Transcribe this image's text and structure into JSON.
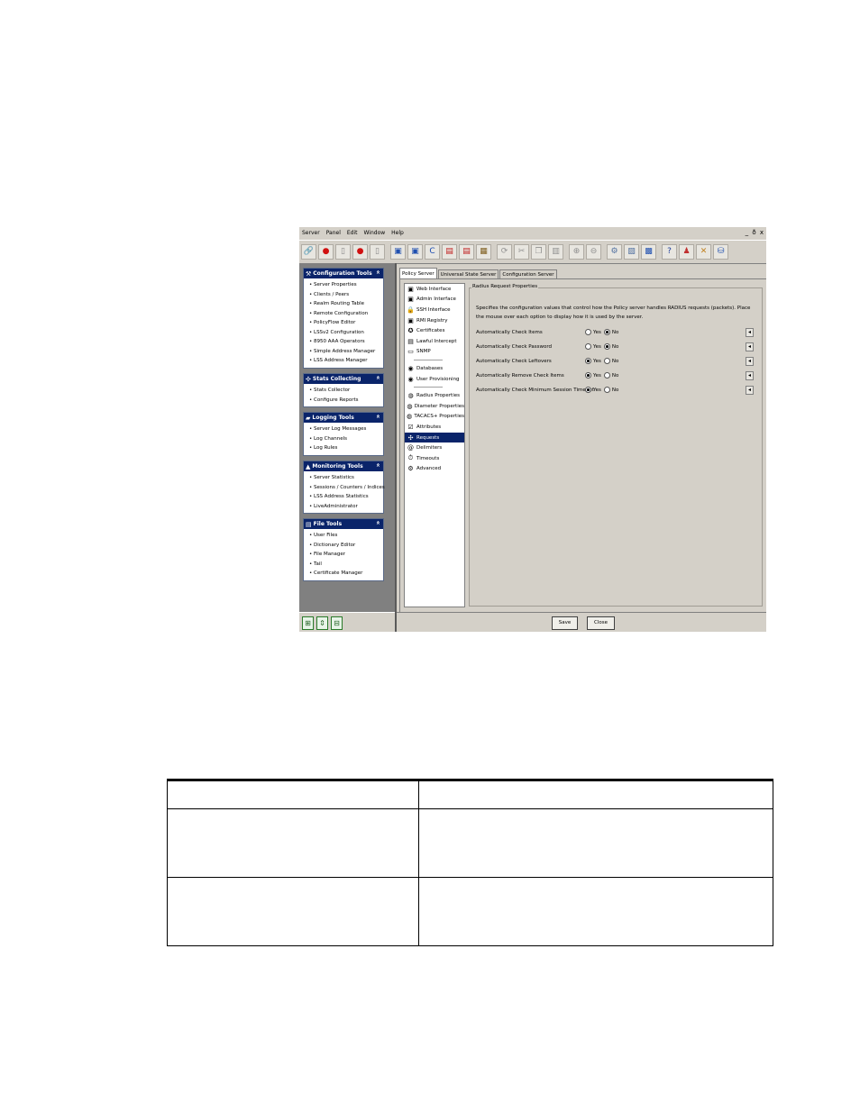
{
  "menu": [
    "Server",
    "Panel",
    "Edit",
    "Window",
    "Help"
  ],
  "window_controls": "_ ð x",
  "toolbar_icons": [
    {
      "name": "link-icon",
      "glyph": "🔗",
      "color": "#c89a2a"
    },
    {
      "name": "red-dot-icon",
      "glyph": "●",
      "color": "#d01010"
    },
    {
      "name": "page-icon",
      "glyph": "▯",
      "color": "#888888"
    },
    {
      "name": "red-dot-icon",
      "glyph": "●",
      "color": "#d01010"
    },
    {
      "name": "page-icon",
      "glyph": "▯",
      "color": "#888888"
    },
    {
      "name": "save-icon",
      "glyph": "▣",
      "color": "#2050b0"
    },
    {
      "name": "save-as-icon",
      "glyph": "▣",
      "color": "#2050b0"
    },
    {
      "name": "refresh-icon",
      "glyph": "C",
      "color": "#1a4ab0"
    },
    {
      "name": "close-doc-icon",
      "glyph": "▤",
      "color": "#c02020"
    },
    {
      "name": "delete-icon",
      "glyph": "▤",
      "color": "#c02020"
    },
    {
      "name": "export-icon",
      "glyph": "▦",
      "color": "#806020"
    },
    {
      "name": "reload-icon",
      "glyph": "⟳",
      "color": "#909090"
    },
    {
      "name": "cut-icon",
      "glyph": "✂",
      "color": "#909090"
    },
    {
      "name": "copy-icon",
      "glyph": "❐",
      "color": "#909090"
    },
    {
      "name": "paste-icon",
      "glyph": "▥",
      "color": "#909090"
    },
    {
      "name": "zoom-in-icon",
      "glyph": "⊕",
      "color": "#909090"
    },
    {
      "name": "zoom-out-icon",
      "glyph": "⊖",
      "color": "#909090"
    },
    {
      "name": "settings-icon",
      "glyph": "⚙",
      "color": "#5070a0"
    },
    {
      "name": "document-icon",
      "glyph": "▨",
      "color": "#5070a0"
    },
    {
      "name": "monitor-icon",
      "glyph": "▩",
      "color": "#2050b0"
    },
    {
      "name": "help-icon",
      "glyph": "?",
      "color": "#1a3a9a"
    },
    {
      "name": "user-icon",
      "glyph": "♟",
      "color": "#c03030"
    },
    {
      "name": "tools-icon",
      "glyph": "✕",
      "color": "#c08020"
    },
    {
      "name": "database-icon",
      "glyph": "⛁",
      "color": "#2050b0"
    }
  ],
  "sidebar": {
    "groups": [
      {
        "title": "Configuration Tools",
        "icon": "⚒",
        "items": [
          "Server Properties",
          "Clients / Peers",
          "Realm Routing Table",
          "Remote Configuration",
          "PolicyFlow Editor",
          "LSSv2 Configuration",
          "8950 AAA Operators",
          "Simple Address Manager",
          "LSS Address Manager"
        ]
      },
      {
        "title": "Stats Collecting",
        "icon": "✣",
        "items": [
          "Stats Collector",
          "Configure Reports"
        ]
      },
      {
        "title": "Logging Tools",
        "icon": "▰",
        "items": [
          "Server Log Messages",
          "Log Channels",
          "Log Rules"
        ]
      },
      {
        "title": "Monitoring Tools",
        "icon": "▲",
        "items": [
          "Server Statistics",
          "Sessions / Counters / Indices",
          "LSS Address Statistics",
          "LiveAdministrator"
        ]
      },
      {
        "title": "File Tools",
        "icon": "▤",
        "items": [
          "User Files",
          "Dictionary Editor",
          "File Manager",
          "Tail",
          "Certificate Manager"
        ]
      }
    ],
    "footer_icons": [
      {
        "name": "add-panel-icon",
        "glyph": "⊞"
      },
      {
        "name": "move-panel-icon",
        "glyph": "⇕"
      },
      {
        "name": "remove-panel-icon",
        "glyph": "⊟"
      }
    ]
  },
  "tabs": [
    "Policy Server",
    "Universal State Server",
    "Configuration Server"
  ],
  "nav": [
    {
      "label": "Web Interface",
      "icon": "▣"
    },
    {
      "label": "Admin Interface",
      "icon": "▣"
    },
    {
      "label": "SSH Interface",
      "icon": "🔒"
    },
    {
      "label": "RMI Registry",
      "icon": "▣"
    },
    {
      "label": "Certificates",
      "icon": "✪"
    },
    {
      "label": "Lawful Intercept",
      "icon": "▤"
    },
    {
      "label": "SNMP",
      "icon": "▭"
    },
    {
      "sep": true
    },
    {
      "label": "Databases",
      "icon": "◉"
    },
    {
      "label": "User Provisioning",
      "icon": "◉"
    },
    {
      "sep": true
    },
    {
      "label": "Radius Properties",
      "icon": "◍"
    },
    {
      "label": "Diameter Properties",
      "icon": "◍"
    },
    {
      "label": "TACACS+ Properties",
      "icon": "◍"
    },
    {
      "label": "Attributes",
      "icon": "☑"
    },
    {
      "label": "Requests",
      "icon": "✣",
      "selected": true
    },
    {
      "label": "Delimiters",
      "icon": "@"
    },
    {
      "label": "Timeouts",
      "icon": "⏱"
    },
    {
      "label": "Advanced",
      "icon": "⚙"
    }
  ],
  "properties": {
    "legend": "Radius Request Properties",
    "description": "Specifies the configuration values that control how the Policy server handles RADIUS requests (packets). Place the mouse over each option to display how it is used by the server.",
    "yes_label": "Yes",
    "no_label": "No",
    "rows": [
      {
        "label": "Automatically Check Items",
        "value": "No"
      },
      {
        "label": "Automatically Check Password",
        "value": "No"
      },
      {
        "label": "Automatically Check Leftovers",
        "value": "Yes"
      },
      {
        "label": "Automatically Remove Check Items",
        "value": "Yes"
      },
      {
        "label": "Automatically Check Minimum Session Timeout",
        "value": "Yes"
      }
    ]
  },
  "buttons": {
    "save": "Save",
    "close": "Close"
  }
}
